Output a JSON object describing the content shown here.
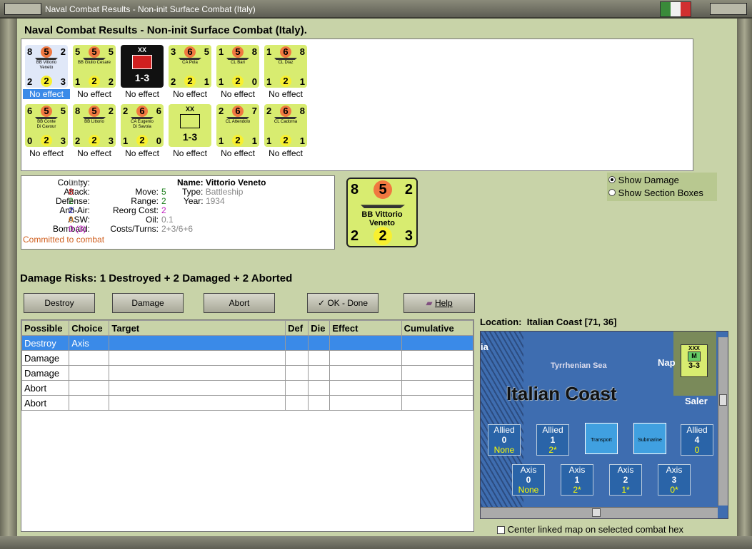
{
  "window": {
    "title": "Naval Combat Results - Non-init Surface Combat (Italy)"
  },
  "heading": "Naval Combat Results - Non-init Surface Combat (Italy).",
  "units_row1": [
    {
      "top": "8",
      "mid": "5",
      "right": "2",
      "name": "BB Vittorio\nVeneto",
      "b1": "2",
      "b2": "2",
      "b3": "3",
      "effect": "No effect",
      "selected": true
    },
    {
      "top": "5",
      "mid": "5",
      "right": "5",
      "name": "BB Giulio Cesare",
      "b1": "1",
      "b2": "2",
      "b3": "2",
      "effect": "No effect"
    },
    {
      "top": "",
      "mid": "XX",
      "right": "",
      "name": "",
      "b1": "",
      "b2": "1-3",
      "b3": "",
      "effect": "No effect",
      "army": true
    },
    {
      "top": "3",
      "mid": "6",
      "right": "5",
      "name": "CA Pola",
      "b1": "2",
      "b2": "2",
      "b3": "1",
      "effect": "No effect"
    },
    {
      "top": "1",
      "mid": "5",
      "right": "8",
      "name": "CL Bari",
      "b1": "1",
      "b2": "2",
      "b3": "0",
      "effect": "No effect"
    },
    {
      "top": "1",
      "mid": "6",
      "right": "8",
      "name": "CL Diaz",
      "b1": "1",
      "b2": "2",
      "b3": "1",
      "effect": "No effect"
    }
  ],
  "units_row2": [
    {
      "top": "6",
      "mid": "5",
      "right": "5",
      "name": "BB Conte\nDi Cavour",
      "b1": "0",
      "b2": "2",
      "b3": "3",
      "effect": "No effect"
    },
    {
      "top": "8",
      "mid": "5",
      "right": "2",
      "name": "BB Littorio",
      "b1": "2",
      "b2": "2",
      "b3": "3",
      "effect": "No effect"
    },
    {
      "top": "2",
      "mid": "6",
      "right": "6",
      "name": "CA Eugenio\nDi Savoia",
      "b1": "1",
      "b2": "2",
      "b3": "0",
      "effect": "No effect"
    },
    {
      "top": "",
      "mid": "XX",
      "right": "",
      "name": "",
      "b1": "",
      "b2": "1-3",
      "b3": "",
      "effect": "No effect",
      "inf": true
    },
    {
      "top": "2",
      "mid": "6",
      "right": "7",
      "name": "CL Attendolo",
      "b1": "1",
      "b2": "2",
      "b3": "1",
      "effect": "No effect"
    },
    {
      "top": "2",
      "mid": "6",
      "right": "8",
      "name": "CL Cadorna",
      "b1": "1",
      "b2": "2",
      "b3": "1",
      "effect": "No effect"
    }
  ],
  "info": {
    "country_label": "Country:",
    "country": "Italy",
    "attack_label": "Attack:",
    "attack": "8",
    "defense_label": "Defense:",
    "defense": "2",
    "antiair_label": "Anti-Air:",
    "antiair": "2",
    "asw_label": "ASW:",
    "asw": "0",
    "bombard_label": "Bombard:",
    "bombard": "0 (3)",
    "committed": "Committed to combat",
    "move_label": "Move:",
    "move": "5",
    "range_label": "Range:",
    "range": "2",
    "reorg_label": "Reorg Cost:",
    "reorg": "2",
    "oil_label": "Oil:",
    "oil": "0.1",
    "costs_label": "Costs/Turns:",
    "costs": "2+3/6+6",
    "name_label": "Name:",
    "name": "Vittorio Veneto",
    "type_label": "Type:",
    "type": "Battleship",
    "year_label": "Year:",
    "year": "1934"
  },
  "big_counter": {
    "top": "8",
    "mid": "5",
    "right": "2",
    "name": "BB Vittorio\nVeneto",
    "b1": "2",
    "b2": "2",
    "b3": "3"
  },
  "radio": {
    "show_damage": "Show Damage",
    "show_sections": "Show Section Boxes"
  },
  "damage_risks": "Damage Risks:  1 Destroyed + 2 Damaged + 2 Aborted",
  "buttons": {
    "destroy": "Destroy",
    "damage": "Damage",
    "abort": "Abort",
    "ok": "OK - Done",
    "help": "Help"
  },
  "table": {
    "headers": [
      "Possible",
      "Choice",
      "Target",
      "Def",
      "Die",
      "Effect",
      "Cumulative"
    ],
    "rows": [
      [
        "Destroy",
        "Axis",
        "",
        "",
        "",
        "",
        ""
      ],
      [
        "Damage",
        "",
        "",
        "",
        "",
        "",
        ""
      ],
      [
        "Damage",
        "",
        "",
        "",
        "",
        "",
        ""
      ],
      [
        "Abort",
        "",
        "",
        "",
        "",
        "",
        ""
      ],
      [
        "Abort",
        "",
        "",
        "",
        "",
        "",
        ""
      ]
    ]
  },
  "location": {
    "label": "Location:",
    "value": "Italian Coast [71, 36]"
  },
  "map": {
    "title": "Italian Coast",
    "sea": "Tyrrhenian Sea",
    "city1": "Nap",
    "city2": "Saler",
    "edge": "ia",
    "allied": [
      {
        "l": "Allied",
        "n": "0",
        "s": "None"
      },
      {
        "l": "Allied",
        "n": "1",
        "s": "2*"
      },
      {
        "l": "Allied",
        "n": "4",
        "s": "0"
      }
    ],
    "axis": [
      {
        "l": "Axis",
        "n": "0",
        "s": "None"
      },
      {
        "l": "Axis",
        "n": "1",
        "s": "2*"
      },
      {
        "l": "Axis",
        "n": "2",
        "s": "1*"
      },
      {
        "l": "Axis",
        "n": "3",
        "s": "0*"
      }
    ],
    "transport": "Transport",
    "submarine": "Submarine",
    "corner_unit": "3-3",
    "corner_top": "XXX"
  },
  "center_linked": "Center linked map on selected combat hex"
}
